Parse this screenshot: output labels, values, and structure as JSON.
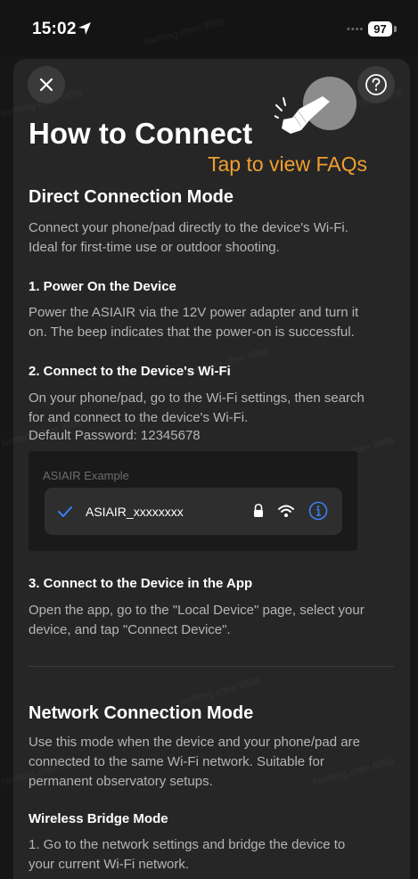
{
  "status_bar": {
    "time": "15:02",
    "battery": "97"
  },
  "header": {
    "title": "How to Connect",
    "faq_hint": "Tap to view FAQs"
  },
  "icons": {
    "close": "close-icon",
    "help": "question-circle-icon",
    "hand": "tap-hand-icon"
  },
  "colors": {
    "background": "#161616",
    "sheet": "#262626",
    "accent_orange": "#f0a030",
    "accent_blue": "#3d7ff5",
    "body_text": "#b5b5b5"
  },
  "direct": {
    "heading": "Direct Connection Mode",
    "intro_1": "Connect your phone/pad directly to the device's Wi-Fi.",
    "intro_2": "Ideal for first-time use or outdoor shooting.",
    "step1": {
      "title": "1. Power On the Device",
      "line_1": "Power the ASIAIR via the 12V power adapter and turn it",
      "line_2": "on. The beep indicates that the power-on is successful."
    },
    "step2": {
      "title": "2. Connect to the Device's Wi-Fi",
      "line_1": "On your phone/pad, go to the Wi-Fi settings, then search",
      "line_2": "for and connect to the device's Wi-Fi.",
      "line_3": "Default Password: 12345678"
    },
    "example": {
      "label": "ASIAIR Example",
      "network_name": "ASIAIR_xxxxxxxx"
    },
    "step3": {
      "title": "3. Connect to the Device in the App",
      "line_1": "Open the app, go to the \"Local Device\" page, select your",
      "line_2": "device, and tap \"Connect Device\"."
    }
  },
  "network": {
    "heading": "Network Connection Mode",
    "intro_1": "Use this mode when the device and your phone/pad are",
    "intro_2": "connected to the same Wi-Fi network. Suitable for",
    "intro_3": "permanent observatory setups.",
    "sub_heading": "Wireless Bridge Mode",
    "item1_line_1": "1. Go to the network settings and bridge the device to",
    "item1_line_2": "your current Wi-Fi network."
  },
  "watermark": "tianfeng.chen 9896"
}
